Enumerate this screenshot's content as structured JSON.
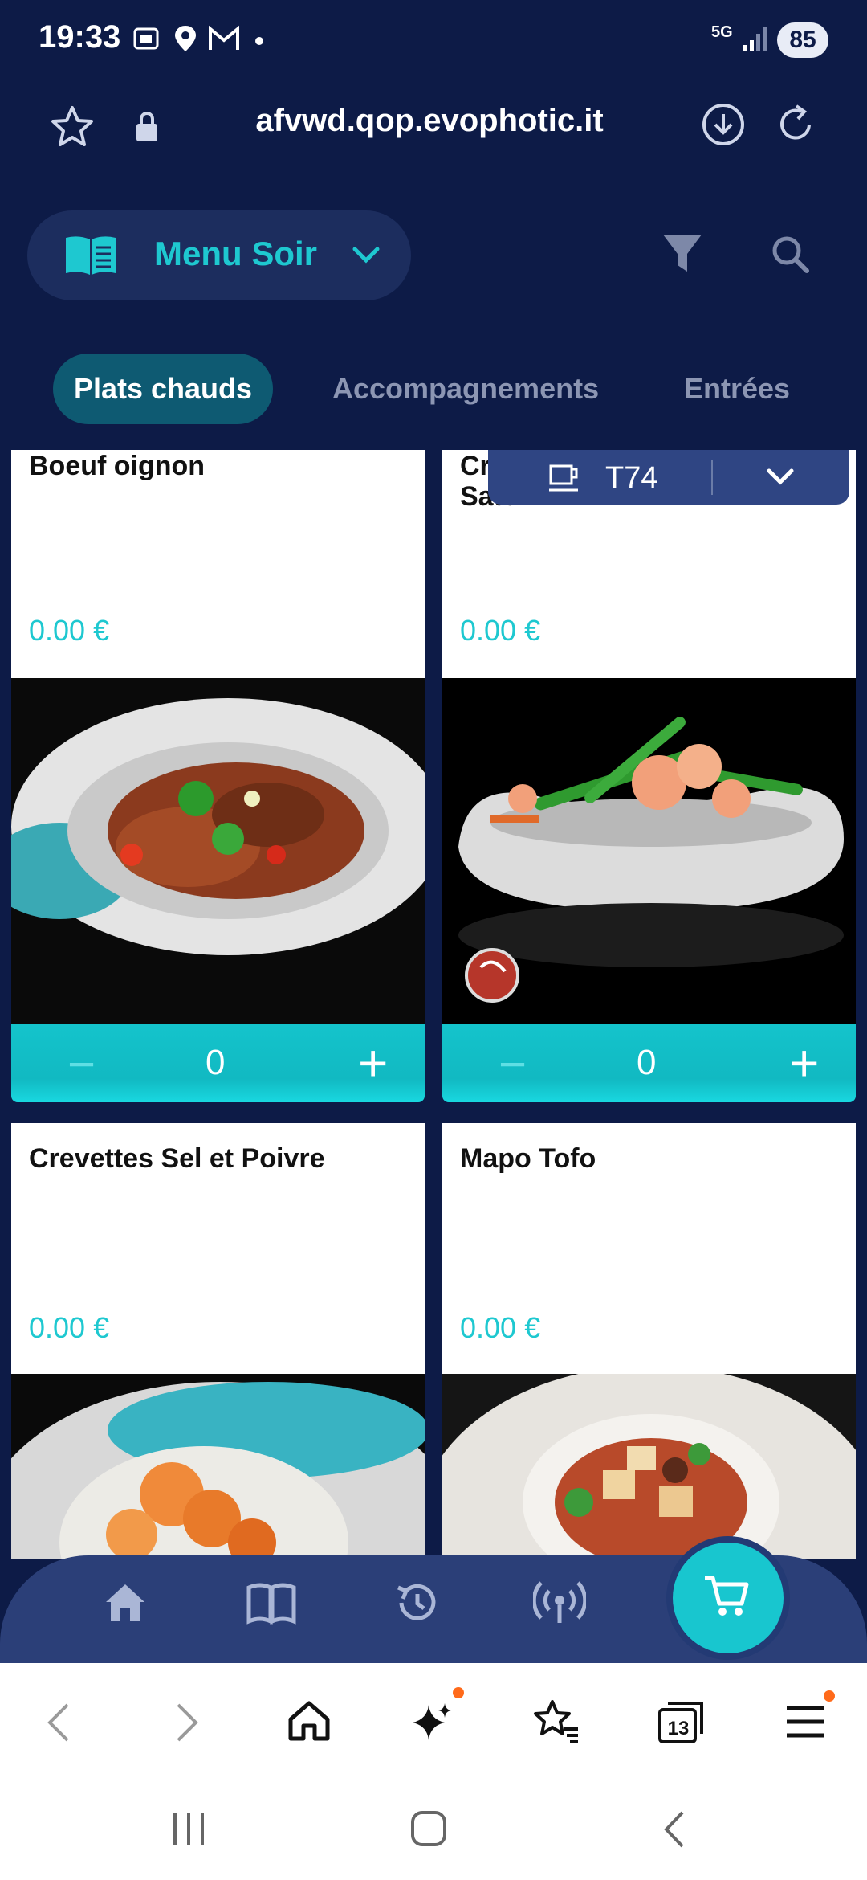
{
  "status_bar": {
    "time": "19:33",
    "network": "5G",
    "battery": "85"
  },
  "browser": {
    "url": "afvwd.qop.evophotic.it",
    "tabs_count": "13"
  },
  "header": {
    "menu_label": "Menu Soir"
  },
  "tabs": [
    {
      "label": "Plats chauds",
      "active": true
    },
    {
      "label": "Accompagnements",
      "active": false
    },
    {
      "label": "Entrées",
      "active": false
    }
  ],
  "table_selector": {
    "label": "T74"
  },
  "products": [
    {
      "name": "Boeuf oignon",
      "price": "0.00 €",
      "qty": "0"
    },
    {
      "name_line1": "Cr",
      "name_line2": "Sate",
      "price": "0.00 €",
      "qty": "0"
    },
    {
      "name": "Crevettes Sel et Poivre",
      "price": "0.00 €"
    },
    {
      "name": "Mapo Tofo",
      "price": "0.00 €"
    }
  ],
  "stepper": {
    "minus": "−",
    "plus": "+"
  },
  "icons": {
    "status": [
      "screenshot-icon",
      "location-icon",
      "gmail-icon",
      "signal-icon"
    ],
    "app_nav": [
      "home-icon",
      "book-icon",
      "history-icon",
      "broadcast-icon",
      "cart-icon"
    ],
    "browser_nav": [
      "back-icon",
      "forward-icon",
      "home-icon",
      "sparkle-icon",
      "bookmarks-icon",
      "tabs-icon",
      "menu-icon"
    ]
  },
  "colors": {
    "accent": "#1ec8d0",
    "background": "#0d1b47",
    "tab_active": "#0e5a72"
  }
}
